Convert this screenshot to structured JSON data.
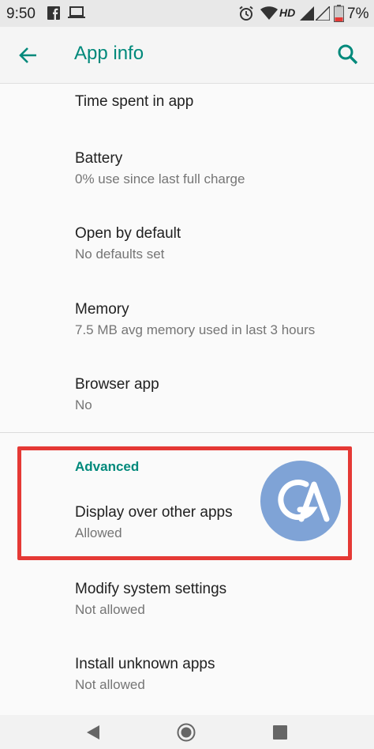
{
  "status_bar": {
    "time": "9:50",
    "battery_pct": "7%",
    "network_label": "HD",
    "icons": [
      "facebook-icon",
      "laptop-icon",
      "alarm-icon",
      "wifi-icon",
      "signal-icon",
      "battery-icon"
    ]
  },
  "app_bar": {
    "title": "App info",
    "back_icon": "arrow-left-icon",
    "search_icon": "search-icon"
  },
  "items": [
    {
      "title": "Time spent in app",
      "subtitle": ""
    },
    {
      "title": "Battery",
      "subtitle": "0% use since last full charge"
    },
    {
      "title": "Open by default",
      "subtitle": "No defaults set"
    },
    {
      "title": "Memory",
      "subtitle": "7.5 MB avg memory used in last 3 hours"
    },
    {
      "title": "Browser app",
      "subtitle": "No"
    }
  ],
  "advanced": {
    "header": "Advanced",
    "items": [
      {
        "title": "Display over other apps",
        "subtitle": "Allowed"
      },
      {
        "title": "Modify system settings",
        "subtitle": "Not allowed"
      },
      {
        "title": "Install unknown apps",
        "subtitle": "Not allowed"
      }
    ]
  },
  "overlay_logo": {
    "text": "GA",
    "color": "#7fa3d6"
  },
  "highlight_color": "#e53935",
  "accent_color": "#00897b",
  "nav_bar": {
    "icons": [
      "back-triangle-icon",
      "home-circle-icon",
      "recents-square-icon"
    ]
  }
}
